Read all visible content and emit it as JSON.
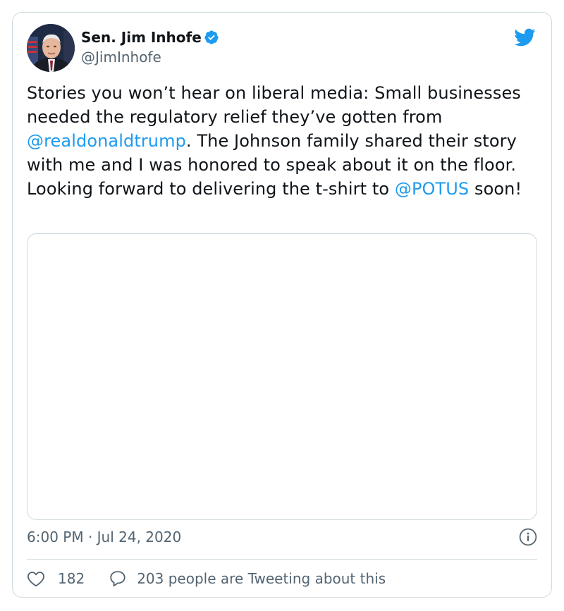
{
  "tweet": {
    "author": {
      "display_name": "Sen. Jim Inhofe",
      "handle": "@JimInhofe",
      "verified": true
    },
    "text": {
      "part1": "Stories you won’t hear on liberal media: Small businesses needed the regulatory relief they’ve gotten from ",
      "mention1": "@realdonaldtrump",
      "part2": ". The Johnson family shared their story with me and I was honored to speak about it on the floor. Looking forward to delivering the t-shirt to ",
      "mention2": "@POTUS",
      "part3": " soon!"
    },
    "timestamp": "6:00 PM · Jul 24, 2020",
    "likes": "182",
    "replies_text": "203 people are Tweeting about this"
  },
  "icons": {
    "brand": "twitter-bird-icon",
    "verified": "verified-badge-icon",
    "info": "info-icon",
    "like": "heart-icon",
    "reply": "speech-bubble-icon"
  },
  "colors": {
    "link": "#1d9bf0",
    "secondary_text": "#536471",
    "border": "#cfd9de",
    "brand_blue": "#1d9bf0"
  }
}
